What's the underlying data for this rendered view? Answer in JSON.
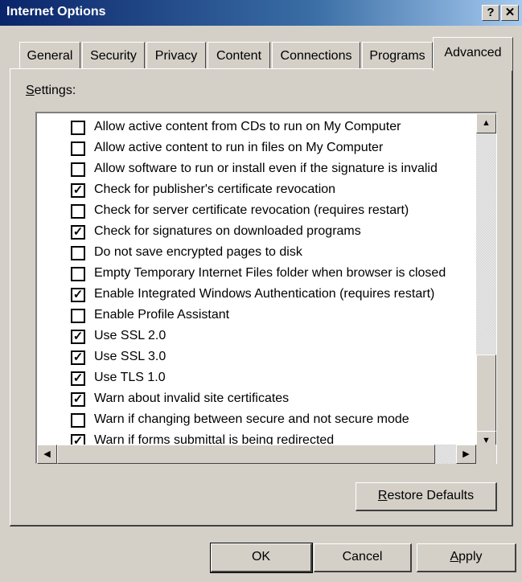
{
  "window": {
    "title": "Internet Options",
    "help_glyph": "?",
    "close_glyph": "✕"
  },
  "tabs": [
    {
      "label": "General"
    },
    {
      "label": "Security"
    },
    {
      "label": "Privacy"
    },
    {
      "label": "Content"
    },
    {
      "label": "Connections"
    },
    {
      "label": "Programs"
    },
    {
      "label": "Advanced",
      "active": true
    }
  ],
  "settings": {
    "label_first": "S",
    "label_rest": "ettings:",
    "items": [
      {
        "label": "Allow active content from CDs to run on My Computer",
        "checked": false
      },
      {
        "label": "Allow active content to run in files on My Computer",
        "checked": false
      },
      {
        "label": "Allow software to run or install even if the signature is invalid",
        "checked": false
      },
      {
        "label": "Check for publisher's certificate revocation",
        "checked": true
      },
      {
        "label": "Check for server certificate revocation (requires restart)",
        "checked": false
      },
      {
        "label": "Check for signatures on downloaded programs",
        "checked": true
      },
      {
        "label": "Do not save encrypted pages to disk",
        "checked": false
      },
      {
        "label": "Empty Temporary Internet Files folder when browser is closed",
        "checked": false
      },
      {
        "label": "Enable Integrated Windows Authentication (requires restart)",
        "checked": true
      },
      {
        "label": "Enable Profile Assistant",
        "checked": false
      },
      {
        "label": "Use SSL 2.0",
        "checked": true
      },
      {
        "label": "Use SSL 3.0",
        "checked": true
      },
      {
        "label": "Use TLS 1.0",
        "checked": true
      },
      {
        "label": "Warn about invalid site certificates",
        "checked": true
      },
      {
        "label": "Warn if changing between secure and not secure mode",
        "checked": false
      },
      {
        "label": "Warn if forms submittal is being redirected",
        "checked": true
      }
    ]
  },
  "buttons": {
    "restore_first": "R",
    "restore_rest": "estore Defaults",
    "ok": "OK",
    "cancel": "Cancel",
    "apply_first": "A",
    "apply_rest": "pply"
  },
  "glyphs": {
    "check": "✓",
    "up": "▲",
    "down": "▼",
    "left": "◀",
    "right": "▶"
  }
}
